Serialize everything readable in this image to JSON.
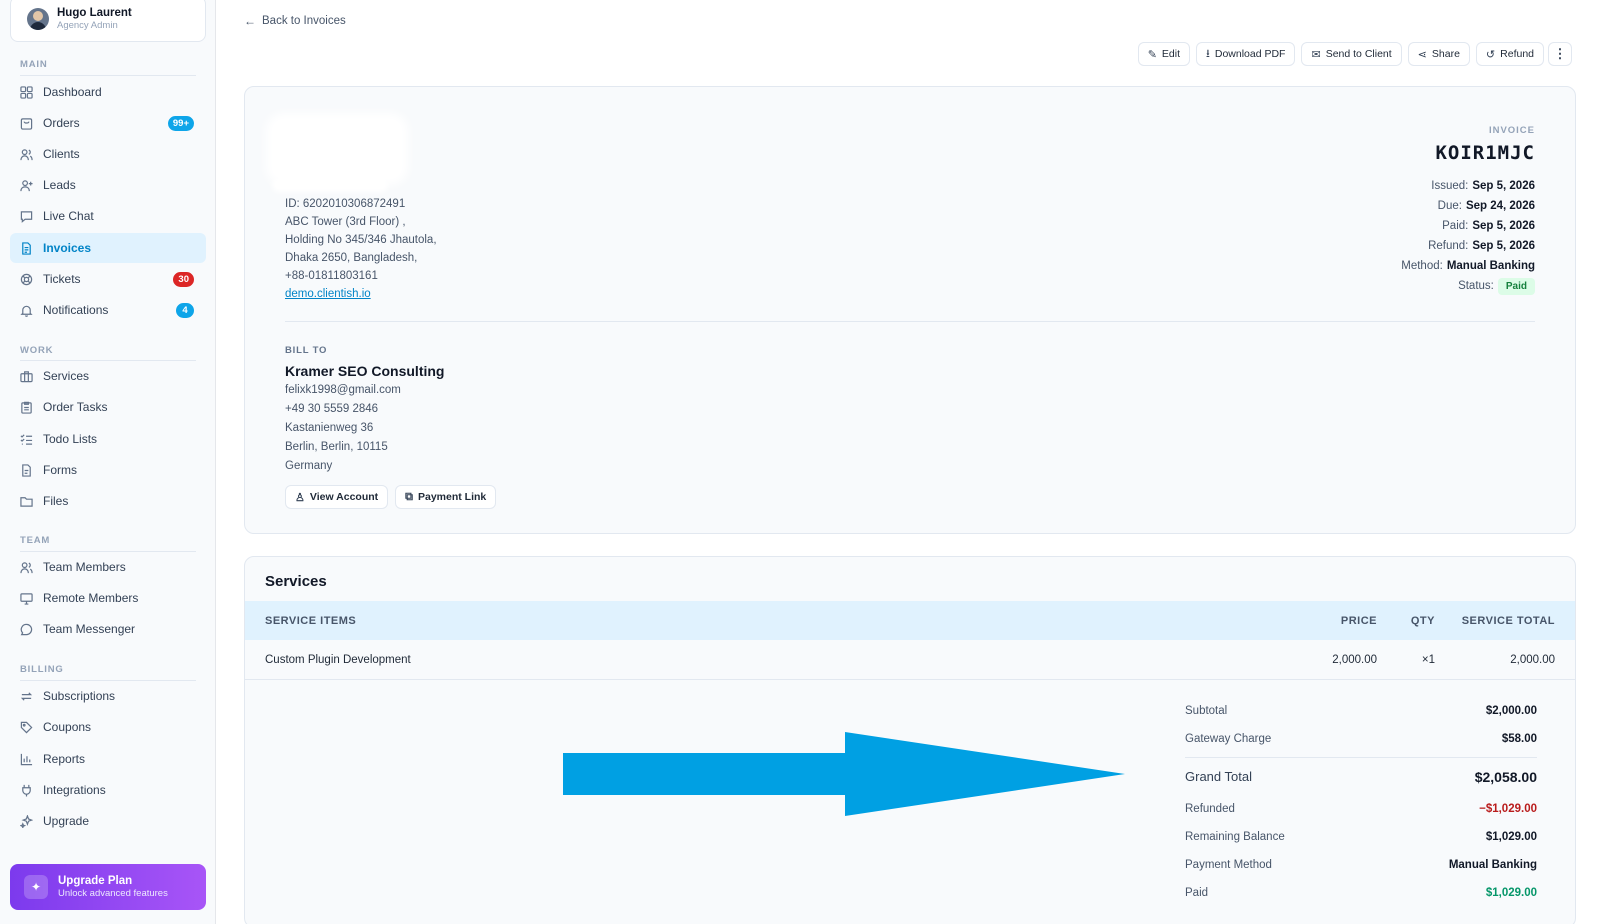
{
  "user": {
    "name": "Hugo Laurent",
    "role": "Agency Admin"
  },
  "sidebar": {
    "sections": {
      "main": "MAIN",
      "work": "WORK",
      "team": "TEAM",
      "billing": "BILLING"
    },
    "items": {
      "dashboard": "Dashboard",
      "orders": "Orders",
      "orders_badge": "99+",
      "clients": "Clients",
      "leads": "Leads",
      "live_chat": "Live Chat",
      "invoices": "Invoices",
      "tickets": "Tickets",
      "tickets_badge": "30",
      "notifications": "Notifications",
      "notifications_badge": "4",
      "services": "Services",
      "order_tasks": "Order Tasks",
      "todo_lists": "Todo Lists",
      "forms": "Forms",
      "files": "Files",
      "team_members": "Team Members",
      "remote_members": "Remote Members",
      "team_messenger": "Team Messenger",
      "subscriptions": "Subscriptions",
      "coupons": "Coupons",
      "reports": "Reports",
      "integrations": "Integrations",
      "upgrade": "Upgrade"
    },
    "active": "Invoices",
    "upgrade_card": {
      "title": "Upgrade Plan",
      "subtitle": "Unlock advanced features"
    }
  },
  "header": {
    "back_label": "Back to Invoices",
    "actions": {
      "edit": "Edit",
      "download_pdf": "Download PDF",
      "send_to_client": "Send to Client",
      "share": "Share",
      "refund": "Refund"
    }
  },
  "company": {
    "id_line": "ID: 6202010306872491",
    "address1": "ABC Tower (3rd Floor) ,",
    "address2": "Holding No 345/346 Jhautola,",
    "address3": "Dhaka 2650, Bangladesh,",
    "phone": "+88-01811803161",
    "website": "demo.clientish.io"
  },
  "invoice": {
    "label": "INVOICE",
    "number": "KOIR1MJC",
    "issued_label": "Issued:",
    "issued": "Sep 5, 2026",
    "due_label": "Due:",
    "due": "Sep 24, 2026",
    "paid_label": "Paid:",
    "paid": "Sep 5, 2026",
    "refund_label": "Refund:",
    "refund": "Sep 5, 2026",
    "method_label": "Method:",
    "method": "Manual Banking",
    "status_label": "Status:",
    "status": "Paid",
    "status_color": "#15803d"
  },
  "bill_to": {
    "label": "BILL TO",
    "name": "Kramer SEO Consulting",
    "email": "felixk1998@gmail.com",
    "phone": "+49 30 5559 2846",
    "street": "Kastanienweg 36",
    "city": "Berlin, Berlin, 10115",
    "country": "Germany",
    "view_account": "View Account",
    "payment_link": "Payment Link"
  },
  "services": {
    "title": "Services",
    "headers": {
      "item": "SERVICE ITEMS",
      "price": "PRICE",
      "qty": "QTY",
      "total": "SERVICE TOTAL"
    },
    "rows": [
      {
        "item": "Custom Plugin Development",
        "price": "2,000.00",
        "qty": "×1",
        "total": "2,000.00"
      }
    ]
  },
  "totals": {
    "subtotal_label": "Subtotal",
    "subtotal": "$2,000.00",
    "gateway_label": "Gateway Charge",
    "gateway": "$58.00",
    "grand_label": "Grand Total",
    "grand": "$2,058.00",
    "refunded_label": "Refunded",
    "refunded": "−$1,029.00",
    "remaining_label": "Remaining Balance",
    "remaining": "$1,029.00",
    "method_label": "Payment Method",
    "method": "Manual Banking",
    "paid_label": "Paid",
    "paid": "$1,029.00"
  },
  "colors": {
    "accent": "#0284c7",
    "annotation_arrow": "#00a0e3",
    "refund_red": "#b91c1c",
    "paid_green": "#059669"
  }
}
